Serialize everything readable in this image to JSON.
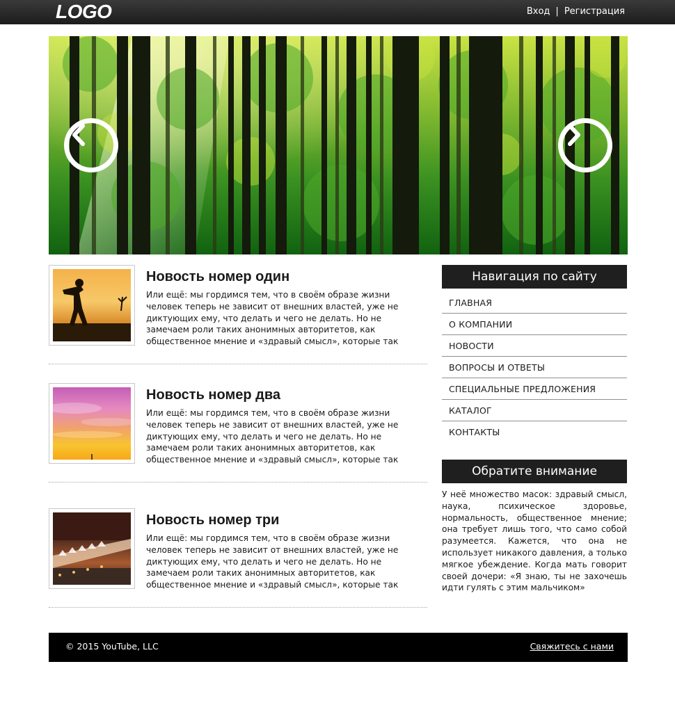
{
  "header": {
    "logo": "LOGO",
    "login": "Вход",
    "separator": "|",
    "register": "Регистрация"
  },
  "slider": {
    "prev_icon": "chevron-left-icon",
    "next_icon": "chevron-right-icon"
  },
  "news": [
    {
      "title": "Новость номер один",
      "text": "Или ещё: мы гордимся тем, что в своём образе жизни человек теперь не зависит от внешних властей, уже не диктующих ему, что делать и чего не делать. Но не замечаем роли таких анонимных авторитетов, как общественное мнение и «здравый смысл», которые так сильны именно потому, что мы готовы"
    },
    {
      "title": "Новость номер два",
      "text": "Или ещё: мы гордимся тем, что в своём образе жизни человек теперь не зависит от внешних властей, уже не диктующих ему, что делать и чего не делать. Но не замечаем роли таких анонимных авторитетов, как общественное мнение и «здравый смысл», которые так сильны именно потому, что мы готовы"
    },
    {
      "title": "Новость номер три",
      "text": "Или ещё: мы гордимся тем, что в своём образе жизни человек теперь не зависит от внешних властей, уже не диктующих ему, что делать и чего не делать. Но не замечаем роли таких анонимных авторитетов, как общественное мнение и «здравый смысл», которые так сильны именно потому, что мы готовы"
    }
  ],
  "sidebar": {
    "nav_title": "Навигация по сайту",
    "nav_items": [
      "ГЛАВНАЯ",
      "О КОМПАНИИ",
      "НОВОСТИ",
      "ВОПРОСЫ И ОТВЕТЫ",
      "СПЕЦИАЛЬНЫЕ ПРЕДЛОЖЕНИЯ",
      "КАТАЛОГ",
      "КОНТАКТЫ"
    ],
    "notice_title": "Обратите внимание",
    "notice_text": "У неё множество масок: здравый смысл, наука, психическое здоровье, нормальность, общественное мнение; она требует лишь того, что само собой разумеется. Кажется, что она не использует никакого давления, а только мягкое убеждение. Когда мать говорит своей дочери: «Я знаю, ты не захочешь идти гулять с этим мальчиком»"
  },
  "footer": {
    "copyright": "© 2015 YouTube, LLC",
    "contact": "Свяжитесь с нами"
  }
}
